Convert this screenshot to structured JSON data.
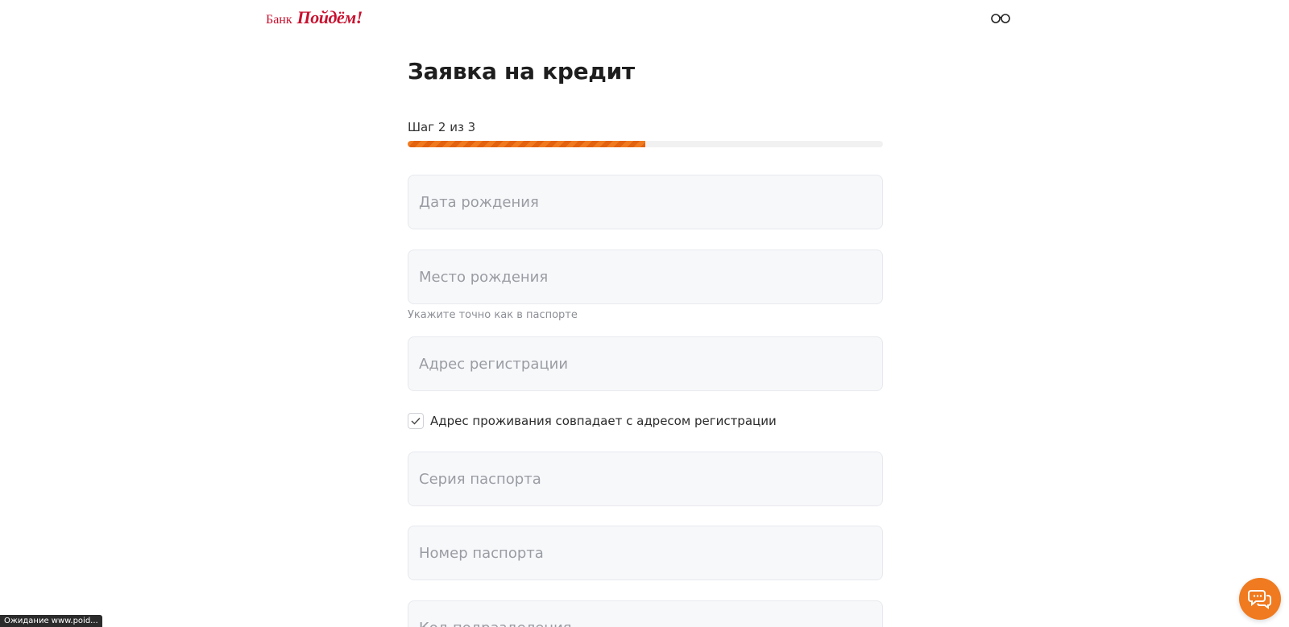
{
  "header": {
    "logo_bank": "Банк",
    "logo_script": "Пойдём!",
    "brand_color": "#c8102e",
    "accessibility_icon": "glasses-icon"
  },
  "form": {
    "title": "Заявка на кредит",
    "step_label": "Шаг 2 из 3",
    "progress": 0.5,
    "progress_color": "#f07a1f",
    "fields": {
      "birth_date": {
        "placeholder": "Дата рождения",
        "value": ""
      },
      "birth_place": {
        "placeholder": "Место рождения",
        "value": "",
        "hint": "Укажите точно как в паспорте"
      },
      "reg_address": {
        "placeholder": "Адрес регистрации",
        "value": ""
      },
      "passport_series": {
        "placeholder": "Серия паспорта",
        "value": ""
      },
      "passport_number": {
        "placeholder": "Номер паспорта",
        "value": ""
      },
      "division_code": {
        "placeholder": "Код подразделения",
        "value": ""
      }
    },
    "same_address": {
      "label": "Адрес проживания совпадает с адресом регистрации",
      "checked": true
    }
  },
  "chat": {
    "icon": "chat-bubbles-icon"
  },
  "status_bar": {
    "text": "Ожидание www.poid..."
  }
}
